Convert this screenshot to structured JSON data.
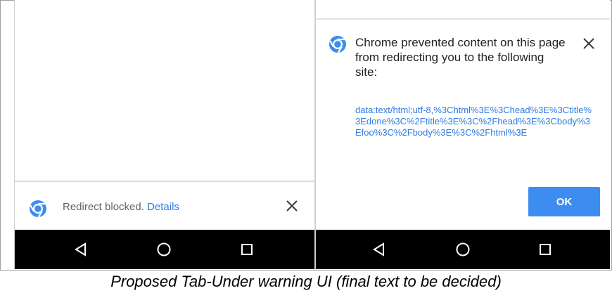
{
  "left_phone": {
    "infobar": {
      "message": "Redirect blocked.",
      "details_link": "Details",
      "icon": "chrome-icon",
      "close_icon": "close-icon"
    }
  },
  "right_phone": {
    "dialog": {
      "message": "Chrome prevented content on this page from redirecting you to the following site:",
      "url": "data:text/html;utf-8,%3Chtml%3E%3Chead%3E%3Ctitle%3Edone%3C%2Ftitle%3E%3C%2Fhead%3E%3Cbody%3Efoo%3C%2Fbody%3E%3C%2Fhtml%3E",
      "ok_label": "OK",
      "icon": "chrome-icon",
      "close_icon": "close-icon"
    }
  },
  "navbar": {
    "icons": [
      "back-icon",
      "home-icon",
      "recents-icon"
    ]
  },
  "caption": "Proposed Tab-Under warning UI (final text to be decided)",
  "colors": {
    "link": "#2d7be5",
    "button": "#3d8df0",
    "navbar": "#000000"
  }
}
